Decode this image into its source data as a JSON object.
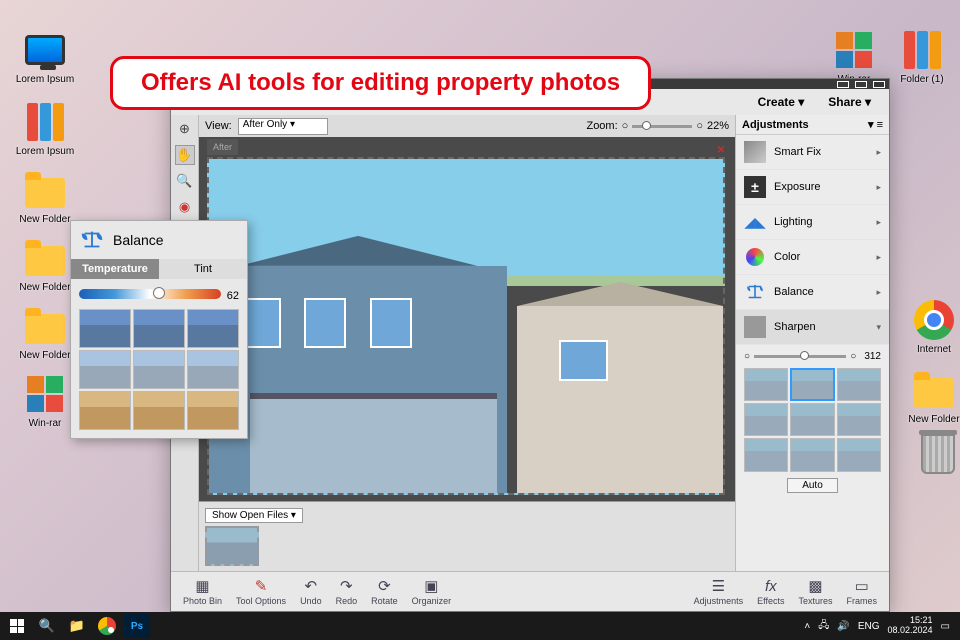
{
  "annotation": "Offers AI tools for editing property photos",
  "desktop": {
    "icons_left": [
      {
        "label": "Lorem Ipsum",
        "type": "pc"
      },
      {
        "label": "Lorem Ipsum",
        "type": "binder"
      },
      {
        "label": "New Folder",
        "type": "folder"
      },
      {
        "label": "New Folder",
        "type": "folder"
      },
      {
        "label": "New Folder",
        "type": "folder"
      },
      {
        "label": "Win-rar",
        "type": "blocks"
      }
    ],
    "icons_right": [
      {
        "label": "Win-rar",
        "type": "blocks"
      },
      {
        "label": "Folder (1)",
        "type": "binder"
      },
      {
        "label": "Internet",
        "type": "chrome"
      },
      {
        "label": "New Folder",
        "type": "folder"
      },
      {
        "label": "",
        "type": "trash"
      }
    ]
  },
  "editor": {
    "menu": {
      "create": "Create",
      "share": "Share"
    },
    "view": {
      "label": "View:",
      "mode": "After Only",
      "zoom_label": "Zoom:",
      "zoom_value": "22%",
      "tab": "After"
    },
    "openfiles": {
      "label": "Show Open Files"
    },
    "bottom": [
      {
        "label": "Photo Bin",
        "ico": "▦"
      },
      {
        "label": "Tool Options",
        "ico": "✎"
      },
      {
        "label": "Undo",
        "ico": "↶"
      },
      {
        "label": "Redo",
        "ico": "↷"
      },
      {
        "label": "Rotate",
        "ico": "⟳"
      },
      {
        "label": "Organizer",
        "ico": "▣"
      }
    ],
    "bottom_right": [
      {
        "label": "Adjustments",
        "ico": "☰"
      },
      {
        "label": "Effects",
        "ico": "fx"
      },
      {
        "label": "Textures",
        "ico": "▩"
      },
      {
        "label": "Frames",
        "ico": "▭"
      }
    ],
    "adjustments": {
      "title": "Adjustments",
      "items": [
        {
          "label": "Smart Fix",
          "ico": "▨",
          "color": "#666"
        },
        {
          "label": "Exposure",
          "ico": "±",
          "color": "#333"
        },
        {
          "label": "Lighting",
          "ico": "◢",
          "color": "#2a7ad4"
        },
        {
          "label": "Color",
          "ico": "◐",
          "color": "linear"
        },
        {
          "label": "Balance",
          "ico": "balance",
          "color": "#2a7ad4"
        },
        {
          "label": "Sharpen",
          "ico": "◆",
          "color": "#888"
        }
      ],
      "sharpen_value": "312",
      "auto": "Auto"
    }
  },
  "balance": {
    "title": "Balance",
    "tabs": {
      "temperature": "Temperature",
      "tint": "Tint"
    },
    "value": "62"
  },
  "taskbar": {
    "lang": "ENG",
    "time": "15:21",
    "date": "08.02.2024"
  }
}
